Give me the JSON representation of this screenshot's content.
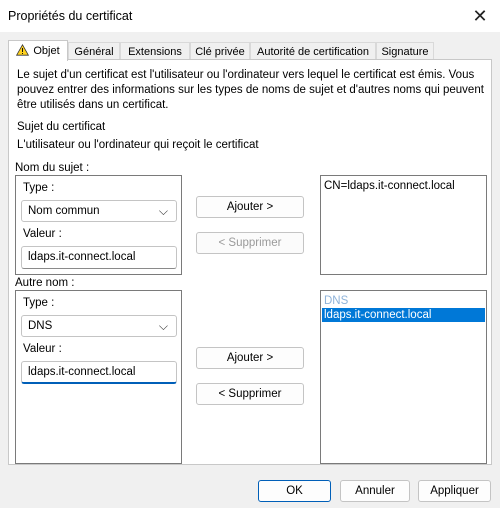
{
  "window": {
    "title": "Propriétés du certificat",
    "close_icon": "close-icon"
  },
  "tabs": [
    {
      "label": "Objet",
      "active": true
    },
    {
      "label": "Général"
    },
    {
      "label": "Extensions"
    },
    {
      "label": "Clé privée"
    },
    {
      "label": "Autorité de certification"
    },
    {
      "label": "Signature"
    }
  ],
  "intro": {
    "description": "Le sujet d'un certificat est l'utilisateur ou l'ordinateur vers lequel le certificat est émis. Vous pouvez entrer des informations sur les types de noms de sujet et d'autres noms qui peuvent être utilisés dans un certificat.",
    "section_title": "Sujet du certificat",
    "section_subtitle": "L'utilisateur ou l'ordinateur qui reçoit le certificat"
  },
  "subject_name": {
    "group_label": "Nom du sujet :",
    "type_label": "Type :",
    "type_value": "Nom commun",
    "value_label": "Valeur :",
    "value": "ldaps.it-connect.local",
    "add_button": "Ajouter >",
    "remove_button": "< Supprimer",
    "list_items": [
      "CN=ldaps.it-connect.local"
    ]
  },
  "alt_name": {
    "group_label": "Autre nom :",
    "type_label": "Type :",
    "type_value": "DNS",
    "value_label": "Valeur :",
    "value": "ldaps.it-connect.local",
    "add_button": "Ajouter >",
    "remove_button": "< Supprimer",
    "list_group": "DNS",
    "list_selected": "ldaps.it-connect.local"
  },
  "footer": {
    "ok": "OK",
    "cancel": "Annuler",
    "apply": "Appliquer"
  },
  "colors": {
    "accent": "#0078d7",
    "focus_border": "#005fb8",
    "group_header": "#8fb3d9"
  }
}
